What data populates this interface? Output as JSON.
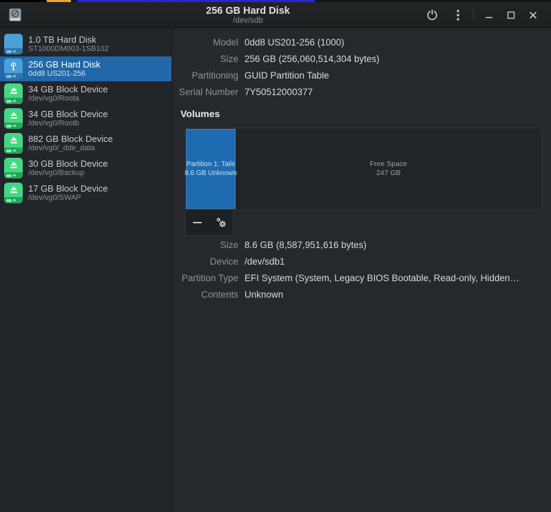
{
  "window": {
    "title": "256 GB Hard Disk",
    "subtitle": "/dev/sdb",
    "app_icon": "gnome-disks",
    "controls": {
      "power": "power-icon",
      "menu": "kebab-menu-icon",
      "minimize": "minimize-icon",
      "maximize": "maximize-icon",
      "close": "close-icon"
    }
  },
  "sidebar": {
    "items": [
      {
        "title": "1.0 TB Hard Disk",
        "subtitle": "ST1000DM003-1SB102",
        "icon": "hard-disk-blue",
        "selected": false
      },
      {
        "title": "256 GB Hard Disk",
        "subtitle": "0dd8 US201-256",
        "icon": "usb-disk-blue",
        "selected": true
      },
      {
        "title": "34 GB Block Device",
        "subtitle": "/dev/vg0/Roota",
        "icon": "block-device-green",
        "selected": false
      },
      {
        "title": "34 GB Block Device",
        "subtitle": "/dev/vg0/Rootb",
        "icon": "block-device-green",
        "selected": false
      },
      {
        "title": "882 GB Block Device",
        "subtitle": "/dev/vg0/_dde_data",
        "icon": "block-device-green",
        "selected": false
      },
      {
        "title": "30 GB Block Device",
        "subtitle": "/dev/vg0/Backup",
        "icon": "block-device-green",
        "selected": false
      },
      {
        "title": "17 GB Block Device",
        "subtitle": "/dev/vg0/SWAP",
        "icon": "block-device-green",
        "selected": false
      }
    ]
  },
  "drive_info": {
    "rows": [
      {
        "label": "Model",
        "value": "0dd8 US201-256 (1000)"
      },
      {
        "label": "Size",
        "value": "256 GB (256,060,514,304 bytes)"
      },
      {
        "label": "Partitioning",
        "value": "GUID Partition Table"
      },
      {
        "label": "Serial Number",
        "value": "7Y50512000377"
      }
    ]
  },
  "volumes": {
    "heading": "Volumes",
    "partition": {
      "line1": "Partition 1: Tails",
      "line2": "8.6 GB Unknown"
    },
    "free_space": {
      "line1": "Free Space",
      "line2": "247 GB"
    },
    "toolbar": {
      "remove": "minus-icon",
      "settings": "gears-icon"
    }
  },
  "volume_info": {
    "rows": [
      {
        "label": "Size",
        "value": "8.6 GB (8,587,951,616 bytes)"
      },
      {
        "label": "Device",
        "value": "/dev/sdb1"
      },
      {
        "label": "Partition Type",
        "value": "EFI System (System, Legacy BIOS Bootable, Read-only, Hidden…"
      },
      {
        "label": "Contents",
        "value": "Unknown"
      }
    ]
  },
  "colors": {
    "selection_blue": "#2268a8",
    "partition_fill": "#1e6bb1",
    "drive_icon_blue": "#4aa0d8",
    "drive_icon_green": "#45d884",
    "strip_orange": "#f0a432",
    "strip_blue": "#2b24d6"
  }
}
